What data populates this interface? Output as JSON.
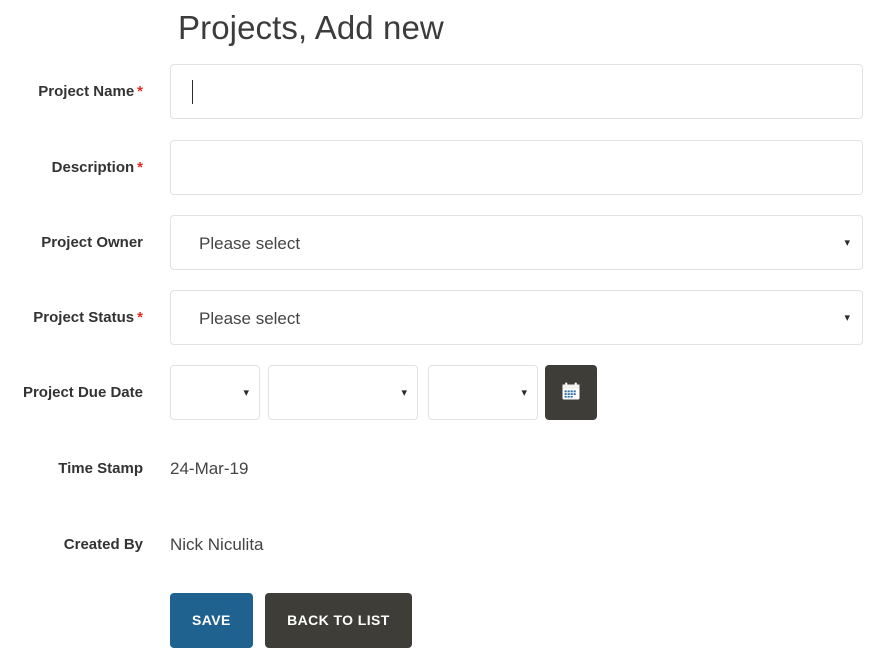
{
  "page": {
    "title": "Projects, Add new"
  },
  "required_marker": "*",
  "colors": {
    "accent_save": "#20628f",
    "accent_dark": "#3e3d38",
    "required_red": "#e02b20",
    "field_border": "#e2e2e0",
    "text": "#333333",
    "value_text": "#444444"
  },
  "fields": {
    "project_name": {
      "label": "Project Name",
      "required": true,
      "value": "",
      "placeholder": ""
    },
    "description": {
      "label": "Description",
      "required": true,
      "value": "",
      "placeholder": ""
    },
    "project_owner": {
      "label": "Project Owner",
      "required": false,
      "selected": "Please select",
      "arrow": "▾"
    },
    "project_status": {
      "label": "Project Status",
      "required": true,
      "selected": "Please select",
      "arrow": "▾"
    },
    "project_due_date": {
      "label": "Project Due Date",
      "required": false,
      "day": "",
      "month": "",
      "year": "",
      "arrow": "▾",
      "calendar_button": "calendar-icon"
    },
    "time_stamp": {
      "label": "Time Stamp",
      "value": "24-Mar-19"
    },
    "created_by": {
      "label": "Created By",
      "value": "Nick Niculita"
    }
  },
  "actions": {
    "save_label": "SAVE",
    "back_label": "BACK TO LIST"
  }
}
